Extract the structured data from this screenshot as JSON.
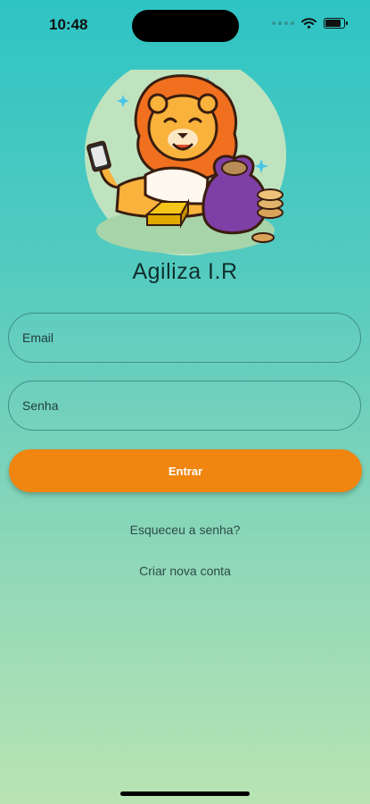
{
  "status_bar": {
    "time": "10:48",
    "icons": [
      "signal-dots-icon",
      "wifi-icon",
      "battery-icon"
    ]
  },
  "app": {
    "title": "Agiliza I.R",
    "logo_icon": "lion-mascot-logo"
  },
  "form": {
    "email_placeholder": "Email",
    "password_placeholder": "Senha",
    "submit_label": "Entrar"
  },
  "links": {
    "forgot_password": "Esqueceu a senha?",
    "create_account": "Criar nova conta"
  },
  "colors": {
    "accent": "#f08510",
    "background_top": "#2ec4c4",
    "background_bottom": "#b9e4b3"
  }
}
